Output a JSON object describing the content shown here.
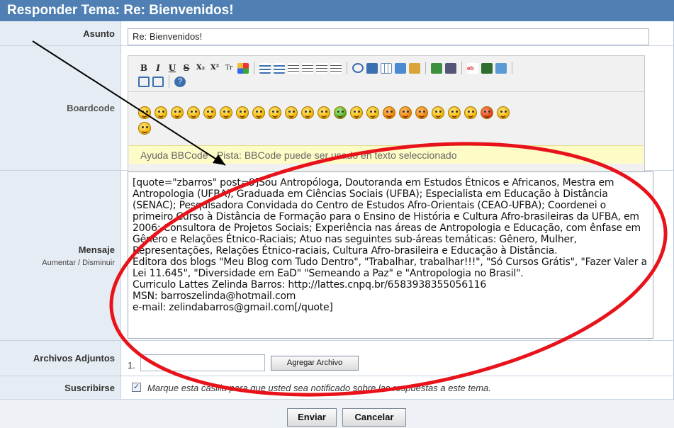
{
  "header": {
    "title": "Responder Tema: Re: Bienvenidos!"
  },
  "labels": {
    "subject": "Asunto",
    "boardcode": "Boardcode",
    "message": "Mensaje",
    "message_sub": "Aumentar / Disminuir",
    "attachments": "Archivos Adjuntos",
    "subscribe": "Suscribirse"
  },
  "subject": {
    "value": "Re: Bienvenidos!"
  },
  "toolbar": {
    "row1": [
      "B",
      "I",
      "U",
      "S",
      "X₂",
      "X²",
      "Tr"
    ],
    "icons": [
      "bold-icon",
      "italic-icon",
      "underline-icon",
      "strikethrough-icon",
      "subscript-icon",
      "superscript-icon",
      "font-size-icon",
      "color-grid-icon",
      "unordered-list-icon",
      "ordered-list-icon",
      "align-left-icon",
      "align-center-icon",
      "align-right-icon",
      "justify-icon",
      "quote-icon",
      "code-icon",
      "table-icon",
      "image-icon",
      "user-icon",
      "smileys-icon",
      "help-icon"
    ],
    "help_text": "Ayuda BBCode - Pista: BBCode puede ser usado en texto seleccionado"
  },
  "message": {
    "text": "[quote=\"zbarros\" post=9]Sou Antropóloga, Doutoranda em Estudos Étnicos e Africanos, Mestra em Antropologia (UFBA), Graduada em Ciências Sociais (UFBA); Especialista em Educação à Distância (SENAC); Pesquisadora Convidada do Centro de Estudos Afro-Orientais (CEAO-UFBA); Coordenei o primeiro Curso à Distância de Formação para o Ensino de História e Cultura Afro-brasileiras da UFBA, em 2006; Consultora de Projetos Sociais; Experiência nas áreas de Antropologia e Educação, com ênfase em Gênero e Relações Étnico-Raciais; Atuo nas seguintes sub-áreas temáticas: Gênero, Mulher, Representações, Relações Étnico-raciais, Cultura Afro-brasileira e Educação à Distância.\nEditora dos blogs \"Meu Blog com Tudo Dentro\", \"Trabalhar, trabalhar!!!\", \"Só Cursos Grátis\", \"Fazer Valer a Lei 11.645\", \"Diversidade em EaD\" \"Semeando a Paz\" e \"Antropologia no Brasil\".\nCurriculo Lattes Zelinda Barros: http://lattes.cnpq.br/6583938355056116\nMSN: barroszelinda@hotmail.com\ne-mail: zelindabarros@gmail.com[/quote]"
  },
  "attachments": {
    "index": "1.",
    "add_button": "Agregar Archivo"
  },
  "subscribe": {
    "checked": true,
    "text": "Marque esta casilla para que usted sea notificado sobre las respuestas a este tema."
  },
  "buttons": {
    "send": "Enviar",
    "cancel": "Cancelar"
  },
  "colors": {
    "header": "#4f7fb3",
    "annotation": "#e8131a",
    "label_bg": "#e6ecf3",
    "help_bg": "#fdfbc6"
  }
}
